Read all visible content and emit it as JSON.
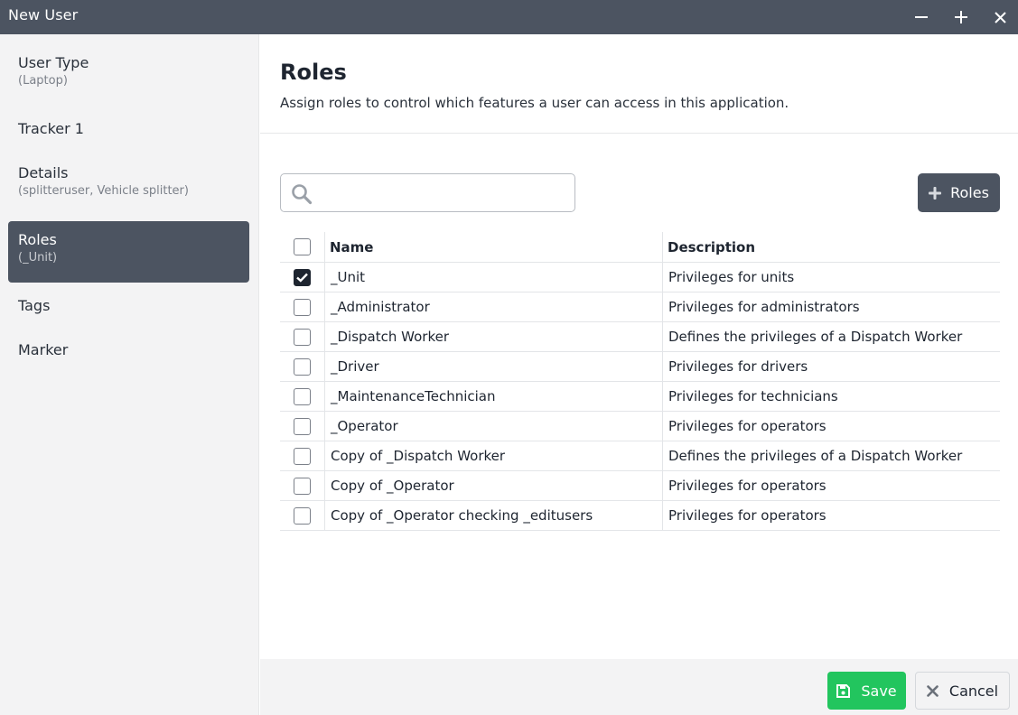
{
  "window": {
    "title": "New User",
    "controls": [
      "minimize-icon",
      "maximize-icon",
      "close-icon"
    ]
  },
  "sidebar": {
    "items": [
      {
        "label": "User Type",
        "sub": "(Laptop)",
        "active": false
      },
      {
        "label": "Tracker 1",
        "sub": "",
        "active": false
      },
      {
        "label": "Details",
        "sub": "(splitteruser, Vehicle splitter)",
        "active": false
      },
      {
        "label": "Roles",
        "sub": "(_Unit)",
        "active": true
      },
      {
        "label": "Tags",
        "sub": "",
        "active": false
      },
      {
        "label": "Marker",
        "sub": "",
        "active": false
      }
    ]
  },
  "main": {
    "title": "Roles",
    "description": "Assign roles to control which features a user can access in this application.",
    "search": {
      "value": "",
      "placeholder": ""
    },
    "add_button_label": "Roles",
    "table": {
      "columns": [
        "Name",
        "Description"
      ],
      "rows": [
        {
          "name": "_Unit",
          "description": "Privileges for units",
          "checked": true
        },
        {
          "name": "_Administrator",
          "description": "Privileges for administrators",
          "checked": false
        },
        {
          "name": "_Dispatch Worker",
          "description": "Defines the privileges of a Dispatch Worker",
          "checked": false
        },
        {
          "name": "_Driver",
          "description": "Privileges for drivers",
          "checked": false
        },
        {
          "name": "_MaintenanceTechnician",
          "description": "Privileges for technicians",
          "checked": false
        },
        {
          "name": "_Operator",
          "description": "Privileges for operators",
          "checked": false
        },
        {
          "name": "Copy of _Dispatch Worker",
          "description": "Defines the privileges of a Dispatch Worker",
          "checked": false
        },
        {
          "name": "Copy of _Operator",
          "description": "Privileges for operators",
          "checked": false
        },
        {
          "name": "Copy of _Operator checking _editusers",
          "description": "Privileges for operators",
          "checked": false
        }
      ]
    }
  },
  "footer": {
    "save_label": "Save",
    "cancel_label": "Cancel"
  },
  "colors": {
    "titlebar": "#4c5461",
    "active_nav": "#4c5461",
    "save": "#22c55e"
  }
}
